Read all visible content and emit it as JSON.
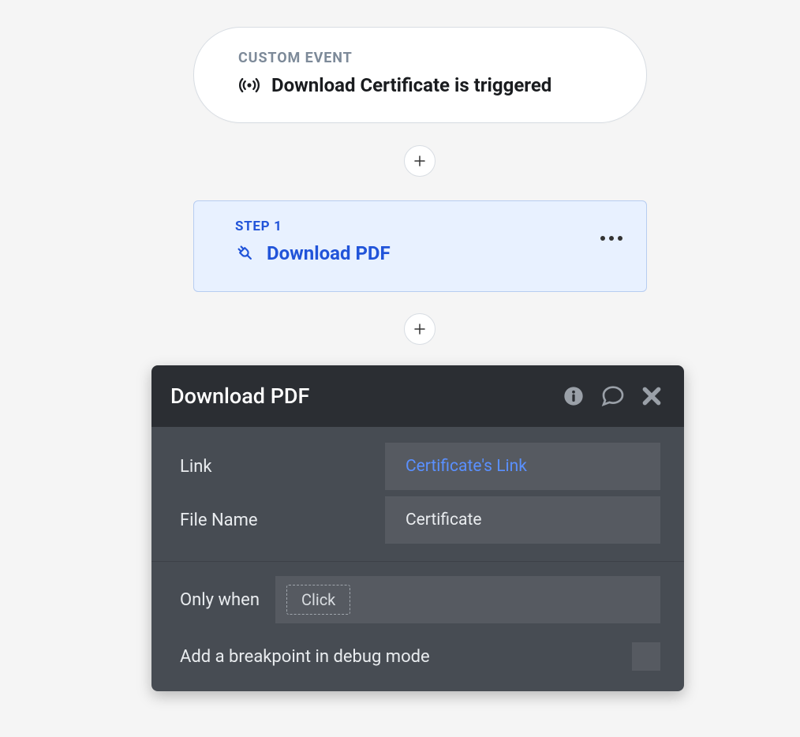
{
  "event": {
    "section_label": "CUSTOM EVENT",
    "title": "Download Certificate is triggered"
  },
  "step": {
    "label": "STEP 1",
    "title": "Download PDF"
  },
  "panel": {
    "title": "Download PDF",
    "props": {
      "link": {
        "label": "Link",
        "value": "Certificate's Link"
      },
      "file_name": {
        "label": "File Name",
        "value": "Certificate"
      }
    },
    "condition": {
      "label": "Only when",
      "placeholder": "Click"
    },
    "breakpoint": {
      "label": "Add a breakpoint in debug mode",
      "checked": false
    }
  }
}
